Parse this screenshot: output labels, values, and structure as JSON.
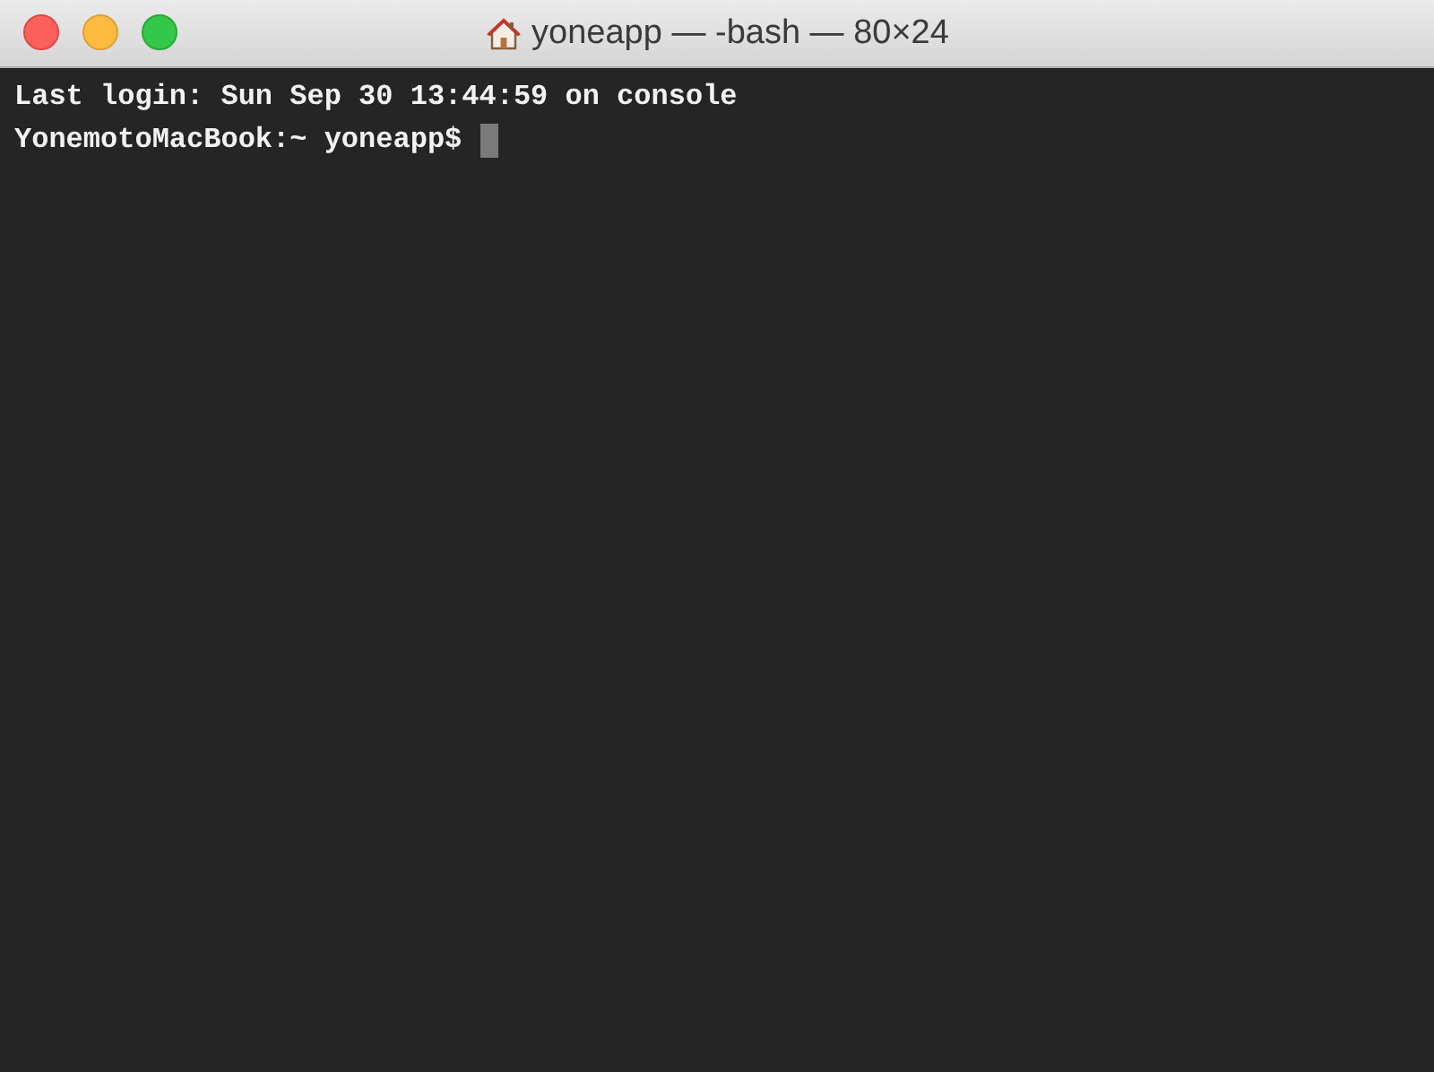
{
  "window": {
    "title": "yoneapp — -bash — 80×24"
  },
  "terminal": {
    "lines": [
      {
        "text": "Last login: Sun Sep 30 13:44:59 on console",
        "cursor": false
      },
      {
        "text": "YonemotoMacBook:~ yoneapp$",
        "cursor": true
      }
    ]
  }
}
